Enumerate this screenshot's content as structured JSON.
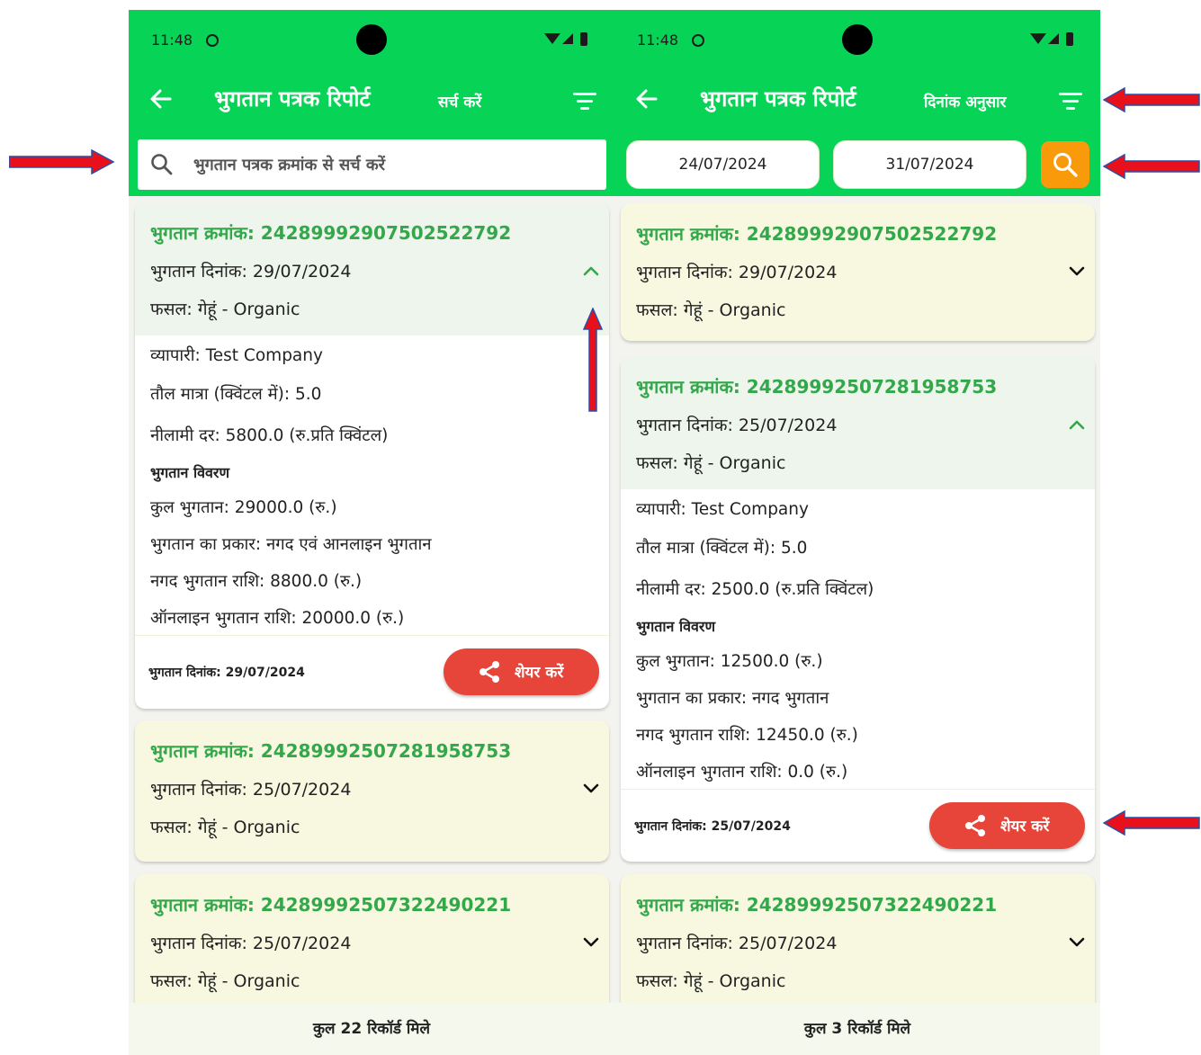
{
  "status": {
    "time": "11:48"
  },
  "left_screen": {
    "title": "भुगतान पत्रक रिपोर्ट",
    "header_action": "सर्च करें",
    "search": {
      "placeholder": "भुगतान पत्रक क्रमांक से सर्च करें",
      "value": ""
    },
    "cards": [
      {
        "number": "भुगतान क्रमांक: 2428999290750252​2792",
        "date": "भुगतान दिनांक: 29/07/2024",
        "crop": "फसल: गेहूं - Organic",
        "expanded": true,
        "details": {
          "trader": "व्यापारी: Test Company",
          "quantity": "तौल मात्रा (क्विंटल में): 5.0",
          "rate": "नीलामी दर: 5800.0 (रु.प्रति क्विंटल)",
          "payment_heading": "भुगतान विवरण",
          "total": "कुल भुगतान: 29000.0 (रु.)",
          "type": "भुगतान का प्रकार: नगद एवं आनलाइन भुगतान",
          "cash": "नगद भुगतान राशि: 8800.0 (रु.)",
          "online": "ऑनलाइन भुगतान राशि: 20000.0 (रु.)"
        },
        "footer_date": "भुगतान दिनांक: 29/07/2024",
        "share_label": "शेयर करें"
      },
      {
        "number": "भुगतान क्रमांक: 24289992507281958753",
        "date": "भुगतान दिनांक: 25/07/2024",
        "crop": "फसल: गेहूं - Organic",
        "expanded": false
      },
      {
        "number": "भुगतान क्रमांक: 24289992507322490221",
        "date": "भुगतान दिनांक: 25/07/2024",
        "crop": "फसल: गेहूं - Organic",
        "expanded": false
      }
    ],
    "footer": "कुल 22 रिकॉर्ड मिले"
  },
  "right_screen": {
    "title": "भुगतान पत्रक रिपोर्ट",
    "header_action": "दिनांक अनुसार",
    "date_from": "24/07/2024",
    "date_to": "31/07/2024",
    "cards": [
      {
        "number": "भुगतान क्रमांक: 24289992907502522792",
        "date": "भुगतान दिनांक: 29/07/2024",
        "crop": "फसल: गेहूं - Organic",
        "expanded": false
      },
      {
        "number": "भुगतान क्रमांक: 24289992507281958753",
        "date": "भुगतान दिनांक: 25/07/2024",
        "crop": "फसल: गेहूं - Organic",
        "expanded": true,
        "details": {
          "trader": "व्यापारी: Test Company",
          "quantity": "तौल मात्रा (क्विंटल में): 5.0",
          "rate": "नीलामी दर: 2500.0 (रु.प्रति क्विंटल)",
          "payment_heading": "भुगतान विवरण",
          "total": "कुल भुगतान: 12500.0 (रु.)",
          "type": "भुगतान का प्रकार: नगद भुगतान",
          "cash": "नगद भुगतान राशि: 12450.0 (रु.)",
          "online": "ऑनलाइन भुगतान राशि: 0.0 (रु.)"
        },
        "footer_date": "भुगतान दिनांक: 25/07/2024",
        "share_label": "शेयर करें"
      },
      {
        "number": "भुगतान क्रमांक: 24289992507322490221",
        "date": "भुगतान दिनांक: 25/07/2024",
        "crop": "फसल: गेहूं - Organic",
        "expanded": false
      }
    ],
    "footer": "कुल 3 रिकॉर्ड मिले"
  },
  "colors": {
    "header_green": "#07d356",
    "card_title_green": "#33a84a",
    "collapsed_card": "#f8f8e1",
    "share_red": "#e8453a",
    "search_orange": "#f99a0b",
    "annotation_red": "#e8101a"
  },
  "icons": {
    "back": "arrow-left-icon",
    "filter": "filter-lines-icon",
    "search": "magnifier-icon",
    "share": "share-nodes-icon",
    "collapse": "chevron-up-icon",
    "expand": "chevron-down-icon"
  }
}
